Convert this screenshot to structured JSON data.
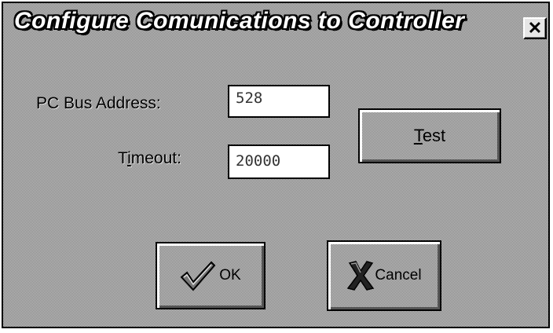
{
  "window": {
    "title": "Configure Comunications to Controller",
    "close_glyph": "✕"
  },
  "form": {
    "bus_address": {
      "label_prefix": "PC Bus Address:",
      "value": "528"
    },
    "timeout": {
      "label_t": "T",
      "label_i": "i",
      "label_rest": "meout:",
      "value": "20000"
    }
  },
  "buttons": {
    "test": {
      "underlined": "T",
      "rest": "est"
    },
    "ok": {
      "label": "OK",
      "icon": "checkmark-icon"
    },
    "cancel": {
      "label": "Cancel",
      "icon": "x-mark-icon"
    }
  },
  "colors": {
    "face": "#c4c4c4",
    "dither_dark": "#000000",
    "field_bg": "#ffffff",
    "text": "#000000"
  }
}
